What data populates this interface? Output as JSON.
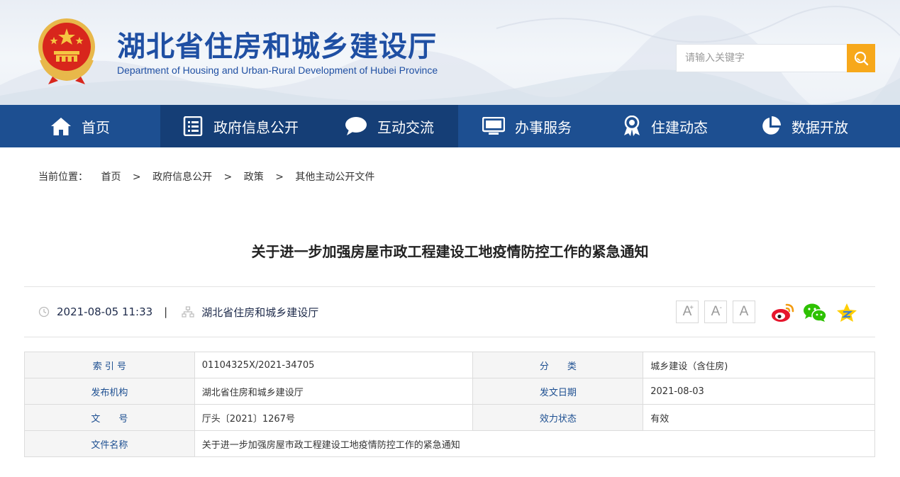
{
  "header": {
    "site_title": "湖北省住房和城乡建设厅",
    "site_subtitle": "Department of Housing and Urban-Rural Development of Hubei Province",
    "search_placeholder": "请输入关键字"
  },
  "nav": {
    "items": [
      {
        "label": "首页",
        "icon": "home-icon"
      },
      {
        "label": "政府信息公开",
        "icon": "document-list-icon"
      },
      {
        "label": "互动交流",
        "icon": "chat-bubble-icon"
      },
      {
        "label": "办事服务",
        "icon": "monitor-icon"
      },
      {
        "label": "住建动态",
        "icon": "award-ribbon-icon"
      },
      {
        "label": "数据开放",
        "icon": "pie-chart-icon"
      }
    ],
    "active_index": 1
  },
  "breadcrumb": {
    "prefix": "当前位置：",
    "items": [
      "首页",
      "政府信息公开",
      "政策",
      "其他主动公开文件"
    ],
    "separator": ">"
  },
  "article": {
    "title": "关于进一步加强房屋市政工程建设工地疫情防控工作的紧急通知",
    "datetime": "2021-08-05 11:33",
    "divider": "|",
    "source": "湖北省住房和城乡建设厅"
  },
  "font_controls": {
    "increase": "A",
    "increase_mark": "+",
    "decrease": "A",
    "decrease_mark": "-",
    "reset": "A"
  },
  "share": [
    "weibo-icon",
    "wechat-icon",
    "qzone-icon"
  ],
  "info_table": {
    "rows": [
      {
        "label1": "索 引 号",
        "value1": "01104325X/2021-34705",
        "label2": "分　　类",
        "value2": "城乡建设（含住房)"
      },
      {
        "label1": "发布机构",
        "value1": "湖北省住房和城乡建设厅",
        "label2": "发文日期",
        "value2": "2021-08-03"
      },
      {
        "label1": "文　　号",
        "value1": "厅头〔2021〕1267号",
        "label2": "效力状态",
        "value2": "有效"
      }
    ],
    "name_label": "文件名称",
    "name_value": "关于进一步加强房屋市政工程建设工地疫情防控工作的紧急通知"
  },
  "colors": {
    "nav_bg": "#1d4f91",
    "nav_active": "#153e76",
    "brand_blue": "#1f4fa3",
    "search_btn": "#f7a81b"
  }
}
